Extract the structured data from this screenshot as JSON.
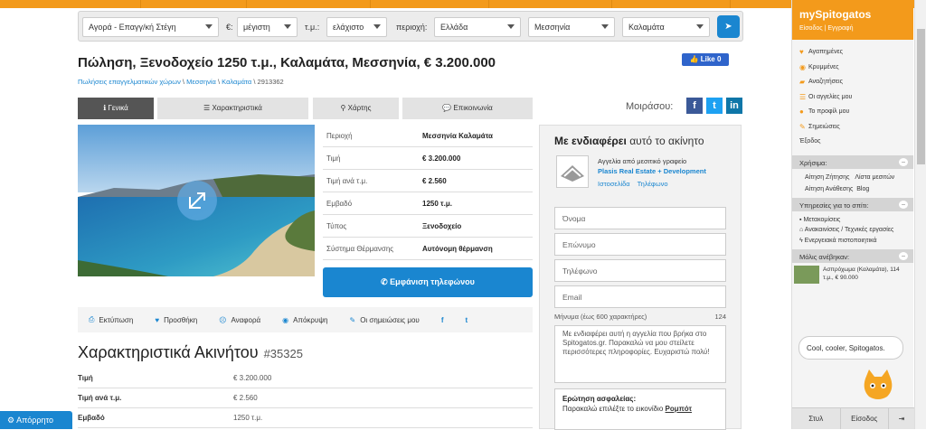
{
  "search": {
    "type_value": "Αγορά - Επαγγ/κή Στέγη",
    "price_label": "€:",
    "price_value": "μέγιστη",
    "area_label": "τ.μ.:",
    "area_value": "ελάχιστο",
    "region_label": "περιοχή:",
    "region_value": "Ελλάδα",
    "prefecture_value": "Μεσσηνία",
    "city_value": "Καλαμάτα"
  },
  "listing": {
    "title": "Πώληση, Ξενοδοχείο 1250 τ.μ., Καλαμάτα, Μεσσηνία, € 3.200.000",
    "breadcrumb": [
      "Πωλήσεις επαγγελματικών χώρων",
      "Μεσσηνία",
      "Καλαμάτα"
    ],
    "breadcrumb_sep": "\\",
    "listing_code": "2913362",
    "like_label": "Like 0"
  },
  "tabs": [
    "Γενικά",
    "Χαρακτηριστικά",
    "Χάρτης",
    "Επικοινωνία"
  ],
  "share_label": "Μοιράσου:",
  "properties": [
    {
      "k": "Περιοχή",
      "v": "Μεσσηνία Καλαμάτα"
    },
    {
      "k": "Τιμή",
      "v": "€ 3.200.000"
    },
    {
      "k": "Τιμή ανά τ.μ.",
      "v": "€ 2.560"
    },
    {
      "k": "Εμβαδό",
      "v": "1250 τ.μ."
    },
    {
      "k": "Τύπος",
      "v": "Ξενοδοχείο"
    },
    {
      "k": "Σύστημα Θέρμανσης",
      "v": "Αυτόνομη θέρμανση"
    }
  ],
  "phone_button": "Εμφάνιση τηλεφώνου",
  "actions": [
    "Εκτύπωση",
    "Προσθήκη",
    "Αναφορά",
    "Απόκρυψη",
    "Οι σημειώσεις μου"
  ],
  "features": {
    "title": "Χαρακτηριστικά Ακινήτου",
    "id": "#35325",
    "rows": [
      {
        "k": "Τιμή",
        "v": "€ 3.200.000"
      },
      {
        "k": "Τιμή ανά τ.μ.",
        "v": "€ 2.560"
      },
      {
        "k": "Εμβαδό",
        "v": "1250 τ.μ."
      }
    ]
  },
  "contact": {
    "title_bold": "Με ενδιαφέρει",
    "title_rest": "αυτό το ακίνητο",
    "agency_line": "Αγγελία από μεσιτικό γραφείο",
    "agency_name": "Plasis Real Estate + Development",
    "website": "Ιστοσελίδα",
    "phone": "Τηλέφωνο",
    "first_name_ph": "Όνομα",
    "last_name_ph": "Επώνυμο",
    "phone_ph": "Τηλέφωνο",
    "email_ph": "Email",
    "message_label": "Μήνυμα (έως 600 χαρακτήρες)",
    "message_count": "124",
    "message_text": "Με ενδιαφέρει αυτή η αγγελία που βρήκα στο Spitogatos.gr. Παρακαλώ να μου στείλετε περισσότερες πληροφορίες. Ευχαριστώ πολύ!",
    "captcha_q": "Ερώτηση ασφαλείας:",
    "captcha_text": "Παρακαλώ επιλέξτε το εικονίδιο",
    "captcha_target": "Ρομπότ"
  },
  "sidebar": {
    "title": "mySpitogatos",
    "login": "Είσοδος",
    "register": "Εγγραφή",
    "items": [
      "Αγαπημένες",
      "Κρυμμένες",
      "Αναζητήσεις",
      "Οι αγγελίες μου",
      "Το προφίλ μου",
      "Σημειώσεις"
    ],
    "exit": "Έξοδος",
    "useful_title": "Χρήσιμα:",
    "useful_links": [
      "Αίτηση Ζήτησης",
      "Λίστα μεσιτών",
      "Αίτηση Ανάθεσης",
      "Blog"
    ],
    "services_title": "Υπηρεσίες για το σπίτι:",
    "services": [
      "Μετακομίσεις",
      "Ανακαινίσεις / Τεχνικές εργασίες",
      "Ενεργειακά πιστοποιητικά"
    ],
    "recent_title": "Μόλις ανέβηκαν:",
    "recent_text": "Ασπρόχωμα (Καλαμάτα), 114 τ.μ., € 90.000",
    "bubble": "Cool, cooler, Spitogatos.",
    "foot": [
      "Στυλ",
      "Είσοδος"
    ]
  },
  "chat_label": "Απόρρητο",
  "colors": {
    "accent": "#f39a1b",
    "link": "#1a86d0"
  }
}
